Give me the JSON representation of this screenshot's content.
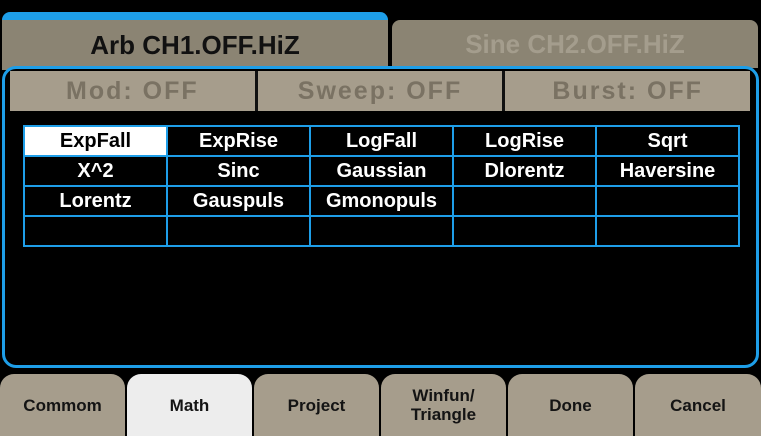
{
  "channels": {
    "active": "Arb CH1.OFF.HiZ",
    "inactive": "Sine CH2.OFF.HiZ"
  },
  "status": {
    "mod": "Mod: OFF",
    "sweep": "Sweep: OFF",
    "burst": "Burst: OFF"
  },
  "waveforms": {
    "rows": [
      [
        "ExpFall",
        "ExpRise",
        "LogFall",
        "LogRise",
        "Sqrt"
      ],
      [
        "X^2",
        "Sinc",
        "Gaussian",
        "Dlorentz",
        "Haversine"
      ],
      [
        "Lorentz",
        "Gauspuls",
        "Gmonopuls",
        "",
        ""
      ],
      [
        "",
        "",
        "",
        "",
        ""
      ]
    ],
    "selected": "ExpFall"
  },
  "softkeys": {
    "commom": "Commom",
    "math": "Math",
    "project": "Project",
    "winfun_line1": "Winfun/",
    "winfun_line2": "Triangle",
    "done": "Done",
    "cancel": "Cancel",
    "selected": "Math"
  },
  "colors": {
    "accent": "#1e9ee8",
    "tab": "#8b8473",
    "softkey": "#a69d8c",
    "softkey_selected": "#ededed"
  }
}
